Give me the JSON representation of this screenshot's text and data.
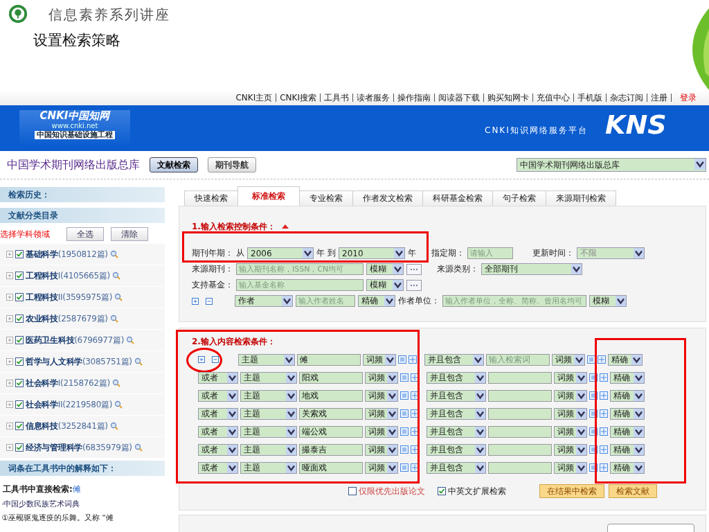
{
  "slide": {
    "title": "信息素养系列讲座",
    "subtitle": "设置检索策略"
  },
  "top_links": [
    "CNKI主页",
    "CNKI搜索",
    "工具书",
    "读者服务",
    "操作指南",
    "阅读器下载",
    "购买知网卡",
    "充值中心",
    "手机版",
    "杂志订阅",
    "注册"
  ],
  "login": "登录",
  "banner": {
    "logo_name": "CNKI中国知网",
    "logo_url": "www.cnki.net",
    "logo_tagline": "中国知识基础设施工程",
    "platform": "CNKI知识网络服务平台",
    "product": "KNS"
  },
  "database_title": "中国学术期刊网络出版总库",
  "nav_buttons": [
    {
      "label": "文献检索",
      "selected": true
    },
    {
      "label": "期刊导航",
      "selected": false
    }
  ],
  "database_select": "中国学术期刊网络出版总库",
  "sidebar": {
    "history_title": "检索历史：",
    "catalog_title": "文献分类目录",
    "choose_label": "选择学科领域",
    "buttons": [
      "全选",
      "清除"
    ],
    "categories": [
      {
        "name": "基础科学",
        "count": "(1950812篇)",
        "checked": true
      },
      {
        "name": "工程科技",
        "suffix": "I",
        "count": "(4105665篇)",
        "checked": true
      },
      {
        "name": "工程科技",
        "suffix": "II",
        "count": "(3595975篇)",
        "checked": true
      },
      {
        "name": "农业科技",
        "count": "(2587679篇)",
        "checked": true
      },
      {
        "name": "医药卫生科技",
        "count": "(6796977篇)",
        "checked": true
      },
      {
        "name": "哲学与人文科学",
        "count": "(3085751篇)",
        "checked": true
      },
      {
        "name": "社会科学",
        "suffix": "I",
        "count": "(2158762篇)",
        "checked": true
      },
      {
        "name": "社会科学",
        "suffix": "II",
        "count": "(2219580篇)",
        "checked": true
      },
      {
        "name": "信息科技",
        "count": "(3252841篇)",
        "checked": true
      },
      {
        "name": "经济与管理科学",
        "count": "(6835979篇)",
        "checked": true
      }
    ],
    "toolbook_title": "词条在工具书中的解释如下：",
    "direct_label": "工具书中直接检索:",
    "direct_term": "傩",
    "source": "·中国少数民族艺术词典",
    "excerpt": "①巫觋驱鬼逐疫的乐舞。又称 “傩"
  },
  "tabs": [
    {
      "label": "快速检索",
      "selected": false
    },
    {
      "label": "标准检索",
      "selected": true
    },
    {
      "label": "专业检索",
      "selected": false
    },
    {
      "label": "作者发文检索",
      "selected": false
    },
    {
      "label": "科研基金检索",
      "selected": false
    },
    {
      "label": "句子检索",
      "selected": false
    },
    {
      "label": "来源期刊检索",
      "selected": false
    }
  ],
  "control": {
    "heading": "1.输入检索控制条件：",
    "year_label": "期刊年期：",
    "from": "从",
    "from_year": "2006",
    "year_unit": "年",
    "to": "到",
    "to_year": "2010",
    "year_unit_2": "年",
    "period_label": "指定期：",
    "period_placeholder": "请输入",
    "update_label": "更新时间：",
    "update_value": "不限",
    "source_label": "来源期刊：",
    "source_placeholder": "输入期刊名称，ISSN，CN均可",
    "source_match": "模糊",
    "source_type_label": "来源类别：",
    "source_type": "全部期刊",
    "fund_label": "支持基金：",
    "fund_placeholder": "输入基金名称",
    "fund_match": "模糊",
    "author_field": "作者",
    "author_placeholder": "输入作者姓名",
    "author_match": "精确",
    "unit_label": "作者单位：",
    "unit_placeholder": "输入作者单位，全称、简称、曾用名均可",
    "unit_match": "模糊"
  },
  "content": {
    "heading": "2.输入内容检索条件：",
    "rows": [
      {
        "kind": "first",
        "field": "主题",
        "term": "傩",
        "freq": "词频",
        "relation": "并且包含",
        "term2_placeholder": "输入检索词",
        "freq2": "词频",
        "match": "精确"
      },
      {
        "kind": "added",
        "logic": "或者",
        "field": "主题",
        "term": "阳戏",
        "freq": "词频",
        "relation": "并且包含",
        "freq2": "词频",
        "match": "精确"
      },
      {
        "kind": "added",
        "logic": "或者",
        "field": "主题",
        "term": "地戏",
        "freq": "词频",
        "relation": "并且包含",
        "freq2": "词频",
        "match": "精确"
      },
      {
        "kind": "added",
        "logic": "或者",
        "field": "主题",
        "term": "关索戏",
        "freq": "词频",
        "relation": "并且包含",
        "freq2": "词频",
        "match": "精确"
      },
      {
        "kind": "added",
        "logic": "或者",
        "field": "主题",
        "term": "端公戏",
        "freq": "词频",
        "relation": "并且包含",
        "freq2": "词频",
        "match": "精确"
      },
      {
        "kind": "added",
        "logic": "或者",
        "field": "主题",
        "term": "撮泰吉",
        "freq": "词频",
        "relation": "并且包含",
        "freq2": "词频",
        "match": "精确"
      },
      {
        "kind": "added",
        "logic": "或者",
        "field": "主题",
        "term": "哑面戏",
        "freq": "词频",
        "relation": "并且包含",
        "freq2": "词频",
        "match": "精确"
      }
    ],
    "options": [
      {
        "label": "仅限优先出版论文",
        "checked": false
      },
      {
        "label": "中英文扩展检索",
        "checked": true
      }
    ],
    "buttons": [
      "在结果中检索",
      "检索文献"
    ]
  }
}
